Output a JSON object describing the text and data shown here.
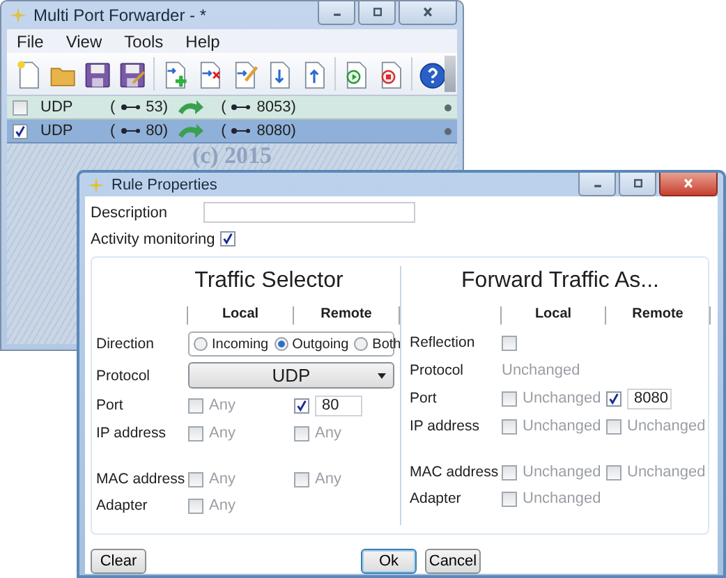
{
  "main_window": {
    "title": "Multi Port Forwarder - *",
    "menu": [
      "File",
      "View",
      "Tools",
      "Help"
    ],
    "rules": [
      {
        "checked": false,
        "selected": false,
        "protocol": "UDP",
        "local_open": "(",
        "local_port": "53)",
        "remote_open": "(",
        "remote_port": "8053)"
      },
      {
        "checked": true,
        "selected": true,
        "protocol": "UDP",
        "local_open": "(",
        "local_port": "80)",
        "remote_open": "(",
        "remote_port": "8080)"
      }
    ],
    "background_text": "(c) 2015"
  },
  "dialog": {
    "title": "Rule Properties",
    "description": {
      "label": "Description"
    },
    "activity_monitoring": {
      "label": "Activity monitoring",
      "checked": true
    },
    "panels": [
      {
        "title": "Traffic Selector",
        "columns": [
          "Local",
          "Remote"
        ],
        "rows": [
          {
            "kind": "radio",
            "label": "Direction",
            "options": [
              {
                "label": "Incoming",
                "selected": false
              },
              {
                "label": "Outgoing",
                "selected": true
              },
              {
                "label": "Both",
                "selected": false
              }
            ]
          },
          {
            "kind": "dropdown",
            "label": "Protocol",
            "value": "UDP"
          },
          {
            "kind": "pair",
            "label": "Port",
            "local": {
              "kind": "label",
              "checked": false,
              "text": "Any"
            },
            "remote": {
              "kind": "field",
              "checked": true,
              "value": "80"
            }
          },
          {
            "kind": "pair",
            "label": "IP address",
            "local": {
              "kind": "label",
              "checked": false,
              "text": "Any"
            },
            "remote": {
              "kind": "label",
              "checked": false,
              "text": "Any"
            }
          },
          {
            "kind": "pair",
            "label": "MAC address",
            "local": {
              "kind": "label",
              "checked": false,
              "text": "Any"
            },
            "remote": {
              "kind": "label",
              "checked": false,
              "text": "Any"
            }
          },
          {
            "kind": "pair",
            "label": "Adapter",
            "local": {
              "kind": "label",
              "checked": false,
              "text": "Any"
            }
          }
        ]
      },
      {
        "title": "Forward Traffic As...",
        "columns": [
          "Local",
          "Remote"
        ],
        "rows": [
          {
            "kind": "check",
            "label": "Reflection",
            "checked": false
          },
          {
            "kind": "static",
            "label": "Protocol",
            "value": "Unchanged"
          },
          {
            "kind": "pair",
            "label": "Port",
            "local": {
              "kind": "label",
              "checked": false,
              "text": "Unchanged"
            },
            "remote": {
              "kind": "field",
              "checked": true,
              "value": "8080"
            }
          },
          {
            "kind": "pair",
            "label": "IP address",
            "local": {
              "kind": "label",
              "checked": false,
              "text": "Unchanged"
            },
            "remote": {
              "kind": "label",
              "checked": false,
              "text": "Unchanged"
            }
          },
          {
            "kind": "pair",
            "label": "MAC address",
            "local": {
              "kind": "label",
              "checked": false,
              "text": "Unchanged"
            },
            "remote": {
              "kind": "label",
              "checked": false,
              "text": "Unchanged"
            }
          },
          {
            "kind": "pair",
            "label": "Adapter",
            "local": {
              "kind": "label",
              "checked": false,
              "text": "Unchanged"
            }
          }
        ]
      }
    ],
    "buttons": [
      {
        "label": "Clear",
        "default": false
      },
      {
        "label": "Ok",
        "default": true
      },
      {
        "label": "Cancel",
        "default": false
      }
    ]
  }
}
